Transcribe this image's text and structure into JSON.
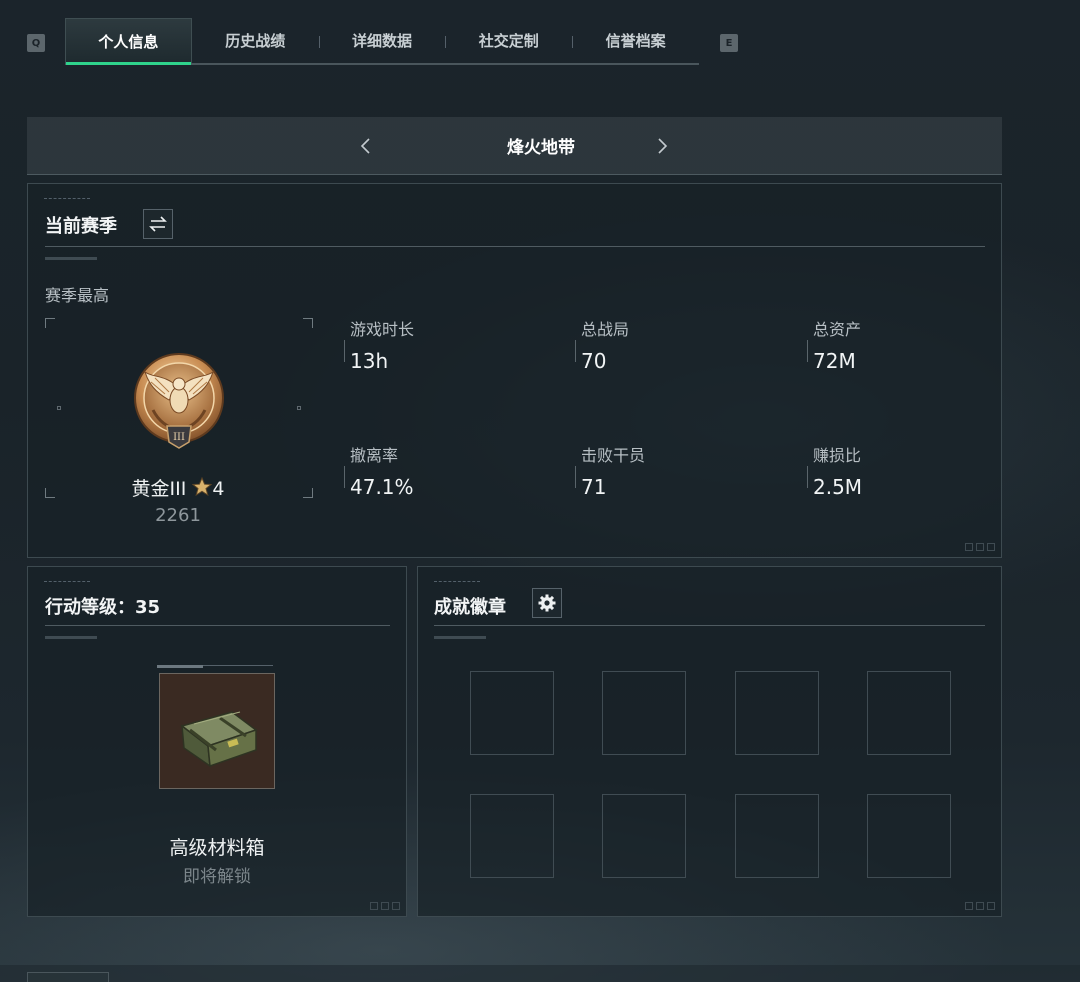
{
  "keys": {
    "left": "Q",
    "right": "E"
  },
  "tabs": [
    {
      "label": "个人信息",
      "active": true
    },
    {
      "label": "历史战绩",
      "active": false
    },
    {
      "label": "详细数据",
      "active": false
    },
    {
      "label": "社交定制",
      "active": false
    },
    {
      "label": "信誉档案",
      "active": false
    }
  ],
  "mode": {
    "title": "烽火地带",
    "prev_icon": "chevron-left-icon",
    "next_icon": "chevron-right-icon"
  },
  "season": {
    "title": "当前赛季",
    "switch_icon": "swap-arrows-icon",
    "best_label": "赛季最高",
    "rank": {
      "name": "黄金III",
      "stars": "4",
      "score": "2261",
      "emblem_icon": "gold-eagle-rank-emblem",
      "star_icon": "star-icon"
    },
    "stats": [
      {
        "label": "游戏时长",
        "value": "13h"
      },
      {
        "label": "总战局",
        "value": "70"
      },
      {
        "label": "总资产",
        "value": "72M"
      },
      {
        "label": "撤离率",
        "value": "47.1%"
      },
      {
        "label": "击败干员",
        "value": "71"
      },
      {
        "label": "赚损比",
        "value": "2.5M"
      }
    ]
  },
  "level": {
    "title": "行动等级：35",
    "reward": {
      "name": "高级材料箱",
      "status": "即将解锁",
      "icon": "military-crate-icon"
    }
  },
  "badges": {
    "title": "成就徽章",
    "settings_icon": "gear-icon",
    "slots": 8
  },
  "colors": {
    "accent": "#2fd38c",
    "gold": "#d9a35c",
    "bg": "#1b242b"
  }
}
